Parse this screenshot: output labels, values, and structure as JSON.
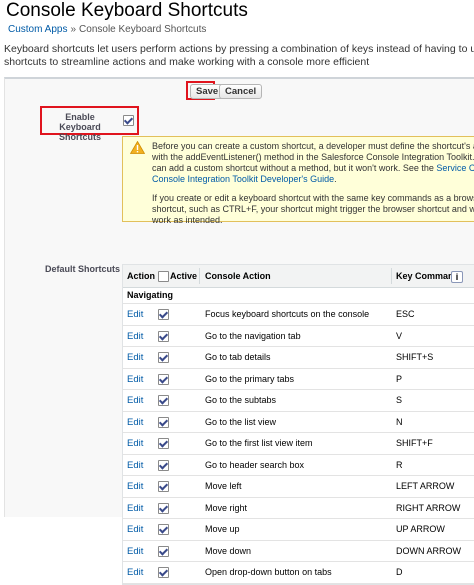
{
  "page": {
    "title": "Console Keyboard Shortcuts",
    "breadcrumb": {
      "parent": "Custom Apps",
      "separator": "»",
      "current": "Console Keyboard Shortcuts"
    },
    "intro_lines": [
      "Keyboard shortcuts let users perform actions by pressing a combination of keys instead of having to use a mouse. You can",
      "shortcuts to streamline actions and make working with a console more efficient"
    ]
  },
  "toolbar": {
    "save_label": "Save",
    "cancel_label": "Cancel"
  },
  "enable": {
    "label": "Enable Keyboard Shortcuts",
    "checked": true
  },
  "warning": {
    "lines_1": [
      "Before you can create a custom shortcut, a developer must define the shortcut's action",
      "with the addEventListener() method in the Salesforce Console Integration Toolkit. You",
      "can add a custom shortcut without a method, but it won't work. See the"
    ],
    "link_line1": "Service Cloud",
    "link_line2": "Console Integration Toolkit Developer's Guide",
    "link_end": ".",
    "lines_2": [
      "If you create or edit a keyboard shortcut with the same key commands as a browser",
      "shortcut, such as CTRL+F, your shortcut might trigger the browser shortcut and won't",
      "work as intended."
    ]
  },
  "shortcuts": {
    "section_label": "Default Shortcuts",
    "columns": {
      "action": "Action",
      "active": "Active",
      "console_action": "Console Action",
      "key_command": "Key Command"
    },
    "info_glyph": "i",
    "group": "Navigating",
    "edit_label": "Edit",
    "rows": [
      {
        "action": "Focus keyboard shortcuts on the console",
        "key": "ESC"
      },
      {
        "action": "Go to the navigation tab",
        "key": "V"
      },
      {
        "action": "Go to tab details",
        "key": "SHIFT+S"
      },
      {
        "action": "Go to the primary tabs",
        "key": "P"
      },
      {
        "action": "Go to the subtabs",
        "key": "S"
      },
      {
        "action": "Go to the list view",
        "key": "N"
      },
      {
        "action": "Go to the first list view item",
        "key": "SHIFT+F"
      },
      {
        "action": "Go to header search box",
        "key": "R"
      },
      {
        "action": "Move left",
        "key": "LEFT ARROW"
      },
      {
        "action": "Move right",
        "key": "RIGHT ARROW"
      },
      {
        "action": "Move up",
        "key": "UP ARROW"
      },
      {
        "action": "Move down",
        "key": "DOWN ARROW"
      },
      {
        "action": "Open drop-down button on tabs",
        "key": "D"
      }
    ]
  },
  "colors": {
    "highlight": "#e0141e",
    "link": "#015ba7",
    "warning_bg": "#ffffd9",
    "warning_icon": "#f2b021"
  }
}
